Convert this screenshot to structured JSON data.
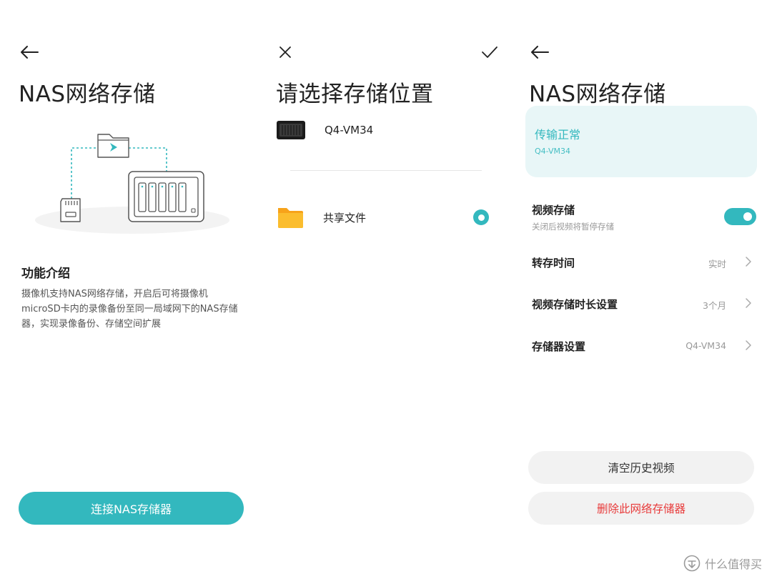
{
  "panel1": {
    "title": "NAS网络存储",
    "feature_heading": "功能介绍",
    "feature_description": "摄像机支持NAS网络存储，开启后可将摄像机microSD卡内的录像备份至同一局域网下的NAS存储器，实现录像备份、存储空间扩展",
    "connect_button_label": "连接NAS存储器"
  },
  "panel2": {
    "title": "请选择存储位置",
    "locations": [
      {
        "name": "Q4-VM34",
        "icon": "nas-device-icon"
      },
      {
        "name": "共享文件",
        "icon": "folder-icon",
        "selected": true
      }
    ]
  },
  "panel3": {
    "title": "NAS网络存储",
    "status": {
      "title": "传输正常",
      "device": "Q4-VM34"
    },
    "settings": [
      {
        "label": "视频存储",
        "sublabel": "关闭后视频将暂停存储",
        "type": "toggle",
        "on": true
      },
      {
        "label": "转存时间",
        "value": "实时",
        "type": "link"
      },
      {
        "label": "视频存储时长设置",
        "value": "3个月",
        "type": "link"
      },
      {
        "label": "存储器设置",
        "value": "Q4-VM34",
        "type": "link"
      }
    ],
    "clear_button_label": "清空历史视频",
    "delete_button_label": "删除此网络存储器"
  },
  "watermark": "什么值得买",
  "colors": {
    "accent": "#33b8be",
    "danger": "#e83b3b",
    "card_bg": "#e8f6f7",
    "button_bg": "#f2f2f2"
  }
}
